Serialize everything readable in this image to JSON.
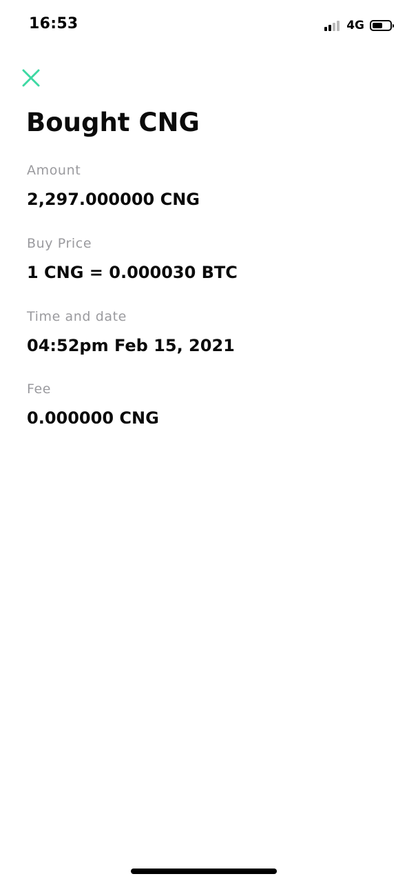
{
  "status_bar": {
    "time": "16:53",
    "network": "4G",
    "signal_bars_active": 2,
    "signal_bars_total": 4,
    "battery_level": 0.6
  },
  "header": {
    "close_icon": "close-icon",
    "accent_color": "#3ed9a3",
    "title": "Bought CNG"
  },
  "details": {
    "amount": {
      "label": "Amount",
      "value": "2,297.000000 CNG"
    },
    "buy_price": {
      "label": "Buy Price",
      "value": "1 CNG = 0.000030 BTC"
    },
    "time_date": {
      "label": "Time and date",
      "value": "04:52pm Feb 15, 2021"
    },
    "fee": {
      "label": "Fee",
      "value": "0.000000 CNG"
    }
  }
}
